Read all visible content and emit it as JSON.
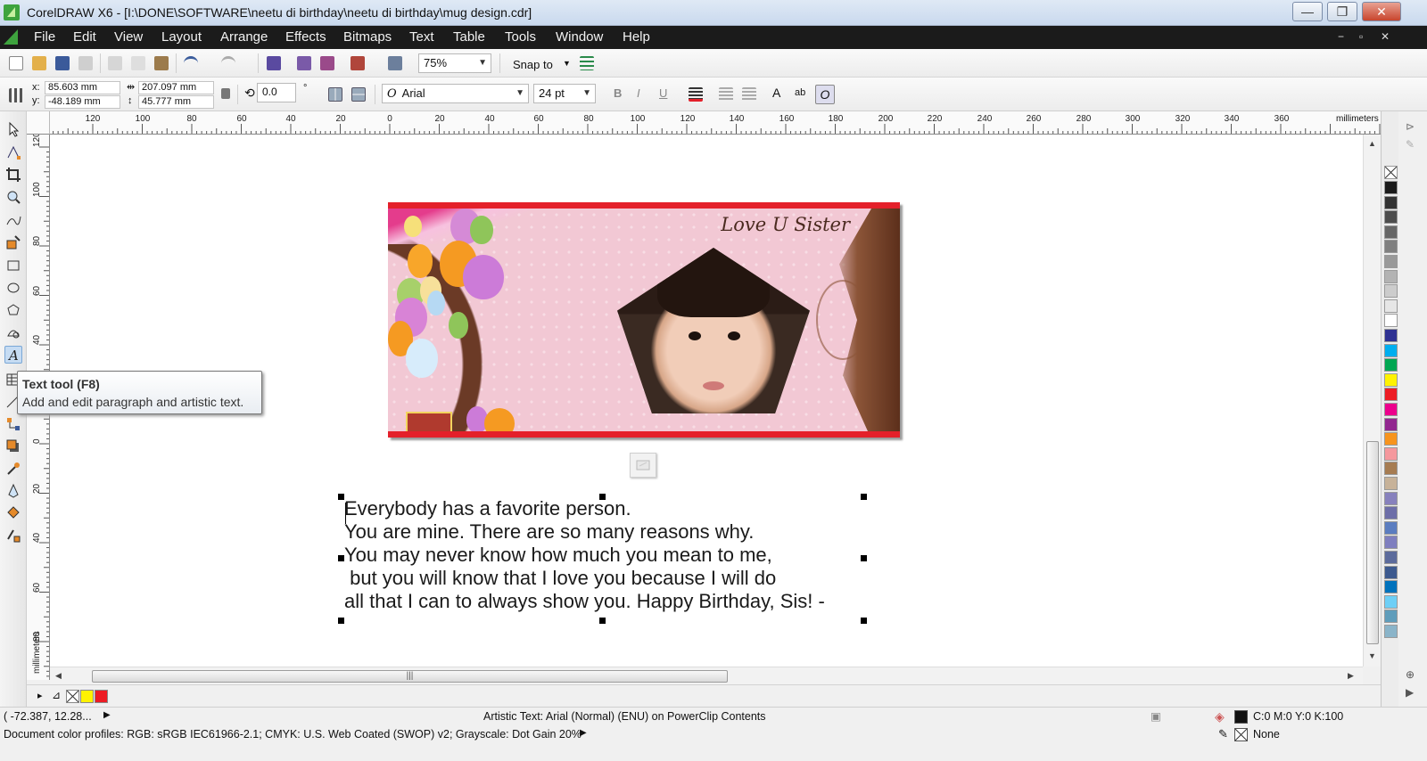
{
  "window": {
    "title": "CorelDRAW X6 - [I:\\DONE\\SOFTWARE\\neetu di birthday\\neetu di birthday\\mug design.cdr]",
    "minimize": "—",
    "restore": "❐",
    "close": "✕"
  },
  "menu": [
    "File",
    "Edit",
    "View",
    "Layout",
    "Arrange",
    "Effects",
    "Bitmaps",
    "Text",
    "Table",
    "Tools",
    "Window",
    "Help"
  ],
  "mdi_controls": [
    "−",
    "▫",
    "✕"
  ],
  "toolbar": {
    "zoom_value": "75%",
    "snap_label": "Snap to"
  },
  "property_bar": {
    "x_label": "x:",
    "x_value": "85.603 mm",
    "y_label": "y:",
    "y_value": "-48.189 mm",
    "width_value": "207.097 mm",
    "height_value": "45.777 mm",
    "rotation_value": "0.0",
    "degree_symbol": "°",
    "font_name": "Arial",
    "font_size": "24 pt",
    "bold_glyph": "B",
    "italic_glyph": "I",
    "underline_glyph": "U"
  },
  "ruler": {
    "unit": "millimeters",
    "h_labels": [
      "120",
      "100",
      "80",
      "60",
      "40",
      "20",
      "0",
      "20",
      "40",
      "60",
      "80",
      "100",
      "120",
      "140",
      "160",
      "180",
      "200",
      "220",
      "240",
      "260",
      "280",
      "300",
      "320",
      "340",
      "360"
    ],
    "v_labels": [
      "120",
      "100",
      "80",
      "60",
      "40",
      "20",
      "0",
      "20",
      "40",
      "60",
      "80"
    ],
    "v_unit": "millimeters"
  },
  "design": {
    "headline": "Love U Sister"
  },
  "text_block": {
    "lines": [
      "Everybody has a favorite person.",
      "You are mine. There are so many reasons why.",
      "You may never know how much you mean to me,",
      " but you will know that I love you because I will do",
      "all that I can to always show you. Happy Birthday, Sis! -"
    ]
  },
  "tooltip": {
    "title": "Text tool (F8)",
    "description": "Add and edit paragraph and artistic text."
  },
  "status": {
    "cursor_position": "( -72.387, 12.28...",
    "object_info": "Artistic Text: Arial (Normal) (ENU) on PowerClip Contents",
    "color_profiles": "Document color profiles: RGB: sRGB IEC61966-2.1; CMYK: U.S. Web Coated (SWOP) v2; Grayscale: Dot Gain 20%",
    "fill_value": "C:0 M:0 Y:0 K:100",
    "outline_value": "None"
  },
  "colors": {
    "accent_red": "#e4202a",
    "mug_pink": "#f2c8d4",
    "palette": [
      "#1a1a1a",
      "#333333",
      "#4d4d4d",
      "#666666",
      "#808080",
      "#999999",
      "#b3b3b3",
      "#cccccc",
      "#e6e6e6",
      "#ffffff",
      "#2e3192",
      "#00aeef",
      "#00a651",
      "#fff200",
      "#ed1c24",
      "#ec008c",
      "#92278f",
      "#f7941d",
      "#f5989d",
      "#a67c52",
      "#c7b299",
      "#8781bd",
      "#6d6ea8",
      "#5b7dc0",
      "#7f7fbf",
      "#5c6b9c",
      "#3d5a8f",
      "#0072bc",
      "#6dcff6",
      "#5f9dbb",
      "#8ab4c9"
    ]
  },
  "icons": {
    "file_icons": [
      "new-icon",
      "open-icon",
      "save-icon",
      "print-icon",
      "cut-icon",
      "copy-icon",
      "paste-icon",
      "undo-icon",
      "redo-icon",
      "import-icon",
      "export-icon",
      "publish-pdf-icon",
      "application-launcher-icon",
      "welcome-screen-icon"
    ],
    "tools": [
      "pick-tool-icon",
      "shape-tool-icon",
      "crop-tool-icon",
      "zoom-tool-icon",
      "freehand-tool-icon",
      "smart-fill-icon",
      "rectangle-tool-icon",
      "ellipse-tool-icon",
      "polygon-tool-icon",
      "basic-shapes-icon",
      "text-tool-icon",
      "table-tool-icon",
      "dimension-tool-icon",
      "connector-tool-icon",
      "drop-shadow-tool-icon",
      "transparency-tool-icon",
      "eyedropper-tool-icon",
      "outline-pen-icon",
      "fill-tool-icon",
      "interactive-fill-icon"
    ]
  }
}
